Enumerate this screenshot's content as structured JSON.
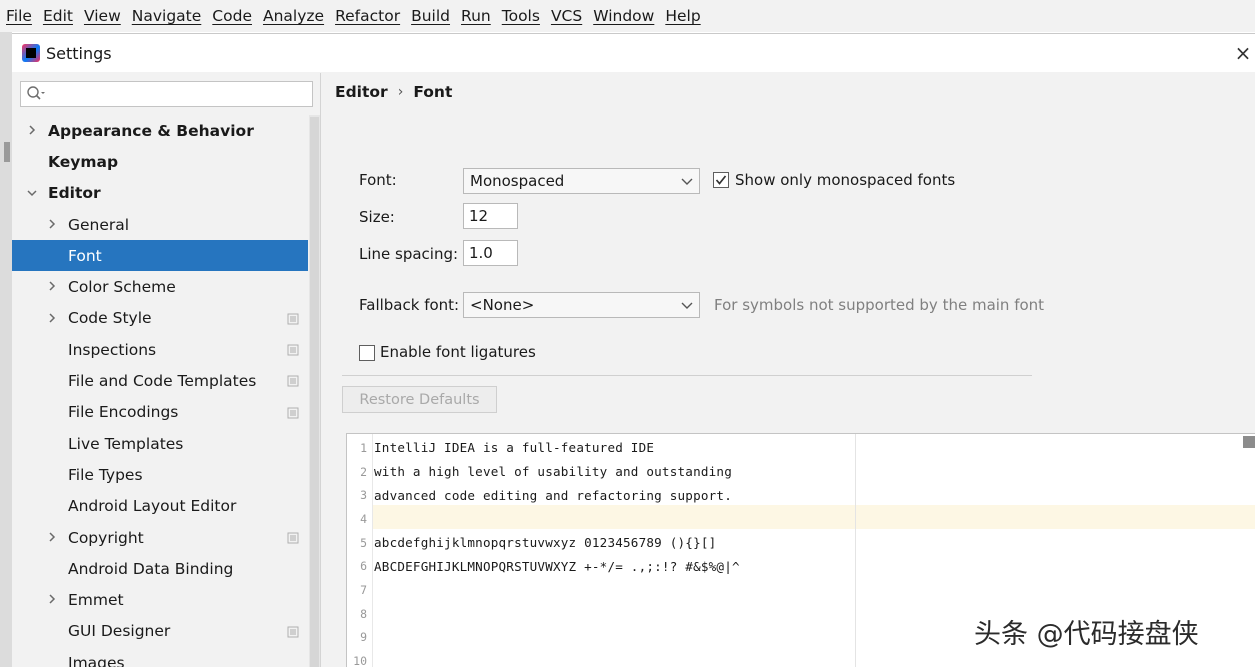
{
  "menubar": {
    "items": [
      "File",
      "Edit",
      "View",
      "Navigate",
      "Code",
      "Analyze",
      "Refactor",
      "Build",
      "Run",
      "Tools",
      "VCS",
      "Window",
      "Help"
    ]
  },
  "dialog": {
    "title": "Settings",
    "close_label": "×"
  },
  "sidebar": {
    "search_placeholder": "",
    "items": [
      {
        "label": "Appearance & Behavior",
        "level": 0,
        "arrow": "right",
        "bold": true,
        "project_icon": false,
        "selected": false
      },
      {
        "label": "Keymap",
        "level": 0,
        "arrow": "none",
        "bold": true,
        "project_icon": false,
        "selected": false
      },
      {
        "label": "Editor",
        "level": 0,
        "arrow": "down",
        "bold": true,
        "project_icon": false,
        "selected": false
      },
      {
        "label": "General",
        "level": 1,
        "arrow": "right",
        "bold": false,
        "project_icon": false,
        "selected": false
      },
      {
        "label": "Font",
        "level": 1,
        "arrow": "none",
        "bold": false,
        "project_icon": false,
        "selected": true
      },
      {
        "label": "Color Scheme",
        "level": 1,
        "arrow": "right",
        "bold": false,
        "project_icon": false,
        "selected": false
      },
      {
        "label": "Code Style",
        "level": 1,
        "arrow": "right",
        "bold": false,
        "project_icon": true,
        "selected": false
      },
      {
        "label": "Inspections",
        "level": 1,
        "arrow": "none",
        "bold": false,
        "project_icon": true,
        "selected": false
      },
      {
        "label": "File and Code Templates",
        "level": 1,
        "arrow": "none",
        "bold": false,
        "project_icon": true,
        "selected": false
      },
      {
        "label": "File Encodings",
        "level": 1,
        "arrow": "none",
        "bold": false,
        "project_icon": true,
        "selected": false
      },
      {
        "label": "Live Templates",
        "level": 1,
        "arrow": "none",
        "bold": false,
        "project_icon": false,
        "selected": false
      },
      {
        "label": "File Types",
        "level": 1,
        "arrow": "none",
        "bold": false,
        "project_icon": false,
        "selected": false
      },
      {
        "label": "Android Layout Editor",
        "level": 1,
        "arrow": "none",
        "bold": false,
        "project_icon": false,
        "selected": false
      },
      {
        "label": "Copyright",
        "level": 1,
        "arrow": "right",
        "bold": false,
        "project_icon": true,
        "selected": false
      },
      {
        "label": "Android Data Binding",
        "level": 1,
        "arrow": "none",
        "bold": false,
        "project_icon": false,
        "selected": false
      },
      {
        "label": "Emmet",
        "level": 1,
        "arrow": "right",
        "bold": false,
        "project_icon": false,
        "selected": false
      },
      {
        "label": "GUI Designer",
        "level": 1,
        "arrow": "none",
        "bold": false,
        "project_icon": true,
        "selected": false
      },
      {
        "label": "Images",
        "level": 1,
        "arrow": "none",
        "bold": false,
        "project_icon": false,
        "selected": false
      }
    ]
  },
  "content": {
    "breadcrumb": {
      "parent": "Editor",
      "separator": "›",
      "current": "Font"
    },
    "font": {
      "label": "Font:",
      "value": "Monospaced"
    },
    "monospaced_only": {
      "label": "Show only monospaced fonts",
      "checked": true
    },
    "size": {
      "label": "Size:",
      "value": "12"
    },
    "line_spacing": {
      "label": "Line spacing:",
      "value": "1.0"
    },
    "fallback_font": {
      "label": "Fallback font:",
      "value": "<None>",
      "hint": "For symbols not supported by the main font"
    },
    "ligatures": {
      "label": "Enable font ligatures",
      "checked": false
    },
    "restore_defaults_label": "Restore Defaults"
  },
  "preview": {
    "lines": [
      {
        "num": "1",
        "text": "IntelliJ IDEA is a full-featured IDE"
      },
      {
        "num": "2",
        "text": "with a high level of usability and outstanding"
      },
      {
        "num": "3",
        "text": "advanced code editing and refactoring support."
      },
      {
        "num": "4",
        "text": ""
      },
      {
        "num": "5",
        "text": "abcdefghijklmnopqrstuvwxyz 0123456789 (){}[]"
      },
      {
        "num": "6",
        "text": "ABCDEFGHIJKLMNOPQRSTUVWXYZ +-*/= .,;:!? #&$%@|^"
      },
      {
        "num": "7",
        "text": ""
      },
      {
        "num": "8",
        "text": ""
      },
      {
        "num": "9",
        "text": ""
      },
      {
        "num": "10",
        "text": ""
      }
    ]
  },
  "watermark": "头条 @代码接盘侠",
  "colors": {
    "selection": "#2675bf",
    "panel_bg": "#f2f2f2",
    "caret_row": "#fdf7e4",
    "hint_text": "#808080"
  }
}
